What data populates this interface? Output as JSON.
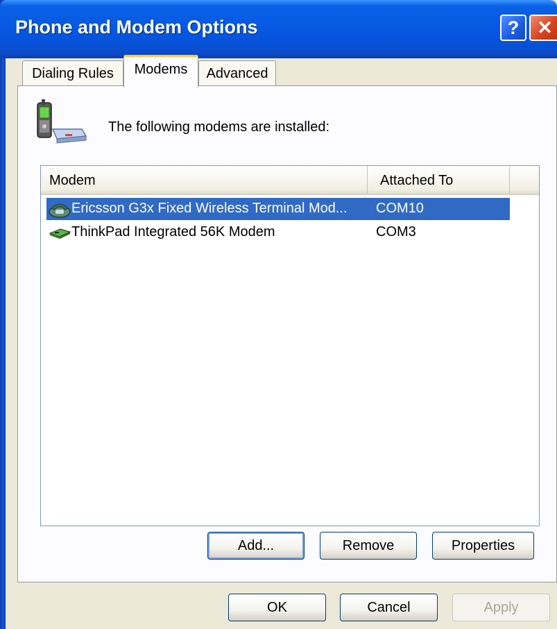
{
  "window": {
    "title": "Phone and Modem Options",
    "help_label": "?",
    "close_label": "✕"
  },
  "tabs": [
    {
      "label": "Dialing Rules",
      "selected": false
    },
    {
      "label": "Modems",
      "selected": true
    },
    {
      "label": "Advanced",
      "selected": false
    }
  ],
  "panel": {
    "info_text": "The following modems are  installed:",
    "icon": "phone-modem-icon"
  },
  "list": {
    "columns": [
      "Modem",
      "Attached To"
    ],
    "rows": [
      {
        "name": "Ericsson G3x Fixed Wireless Terminal Mod...",
        "port": "COM10",
        "icon": "telephone-modem-icon",
        "selected": true
      },
      {
        "name": "ThinkPad Integrated 56K Modem",
        "port": "COM3",
        "icon": "modem-card-icon",
        "selected": false
      }
    ]
  },
  "panel_buttons": {
    "add": "Add...",
    "remove": "Remove",
    "properties": "Properties"
  },
  "dialog_buttons": {
    "ok": "OK",
    "cancel": "Cancel",
    "apply": "Apply"
  },
  "colors": {
    "titlebar": "#0758e2",
    "selection": "#316ac5",
    "tab_highlight": "#ffc83c",
    "close": "#d8431f"
  }
}
